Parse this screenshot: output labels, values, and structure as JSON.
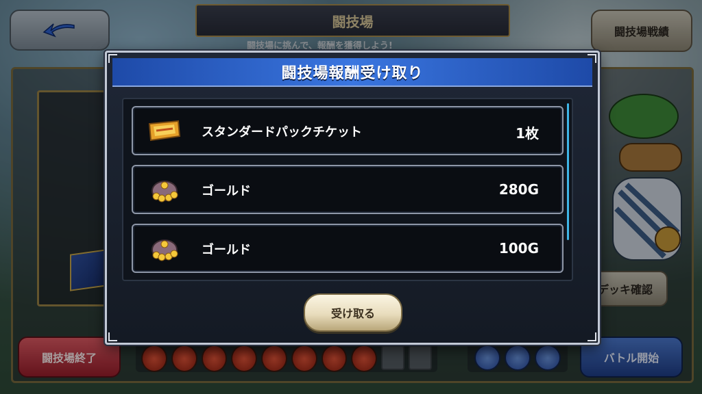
{
  "background": {
    "title": "闘技場",
    "subtitle": "闘技場に挑んで、報酬を獲得しよう!",
    "record_button": "闘技場戦績",
    "deck_button": "デッキ確認",
    "end_button": "闘技場終了",
    "start_button": "バトル開始"
  },
  "modal": {
    "title": "闘技場報酬受け取り",
    "items": [
      {
        "name": "スタンダードパックチケット",
        "quantity": "1枚",
        "icon": "ticket-icon"
      },
      {
        "name": "ゴールド",
        "quantity": "280G",
        "icon": "gold-bag-icon"
      },
      {
        "name": "ゴールド",
        "quantity": "100G",
        "icon": "gold-bag-icon"
      }
    ],
    "receive_button": "受け取る"
  },
  "colors": {
    "header_blue": "#2f63c8",
    "scroll_accent": "#3fb6e8",
    "end_red": "#c63442",
    "start_blue": "#2f5cb0"
  }
}
